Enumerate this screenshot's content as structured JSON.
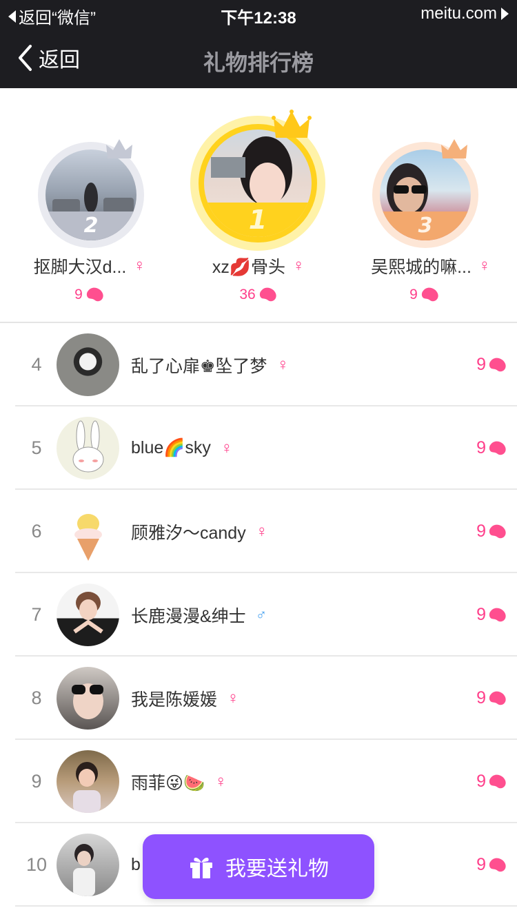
{
  "status_bar": {
    "back_app": "返回“微信”",
    "time": "下午12:38",
    "site": "meitu.com"
  },
  "nav": {
    "back_label": "返回",
    "title": "礼物排行榜"
  },
  "podium": [
    {
      "rank": "2",
      "name": "抠脚大汉d...",
      "gender": "♀",
      "count": "9"
    },
    {
      "rank": "1",
      "name": "xz💋骨头",
      "gender": "♀",
      "count": "36"
    },
    {
      "rank": "3",
      "name": "吴熙城的嘛...",
      "gender": "♀",
      "count": "9"
    }
  ],
  "list": [
    {
      "rank": "4",
      "name": "乱了心扉♚坠了梦",
      "gender": "♀",
      "count": "9"
    },
    {
      "rank": "5",
      "name": "blue🌈sky",
      "gender": "♀",
      "count": "9"
    },
    {
      "rank": "6",
      "name": "顾雅汐～candy",
      "gender": "♀",
      "count": "9"
    },
    {
      "rank": "7",
      "name": "长鹿漫漫&绅士",
      "gender": "♂",
      "count": "9"
    },
    {
      "rank": "8",
      "name": "我是陈媛媛",
      "gender": "♀",
      "count": "9"
    },
    {
      "rank": "9",
      "name": "雨菲😜🍉",
      "gender": "♀",
      "count": "9"
    },
    {
      "rank": "10",
      "name": "b",
      "gender": "",
      "count": "9"
    }
  ],
  "send_button": {
    "label": "我要送礼物"
  },
  "colors": {
    "nav_bg": "#1d1d21",
    "accent_pink": "#ff3e8a",
    "gold": "#ffd21e",
    "silver": "#b9bdc9",
    "bronze": "#f3a86d",
    "button_purple": "#8e52ff"
  }
}
